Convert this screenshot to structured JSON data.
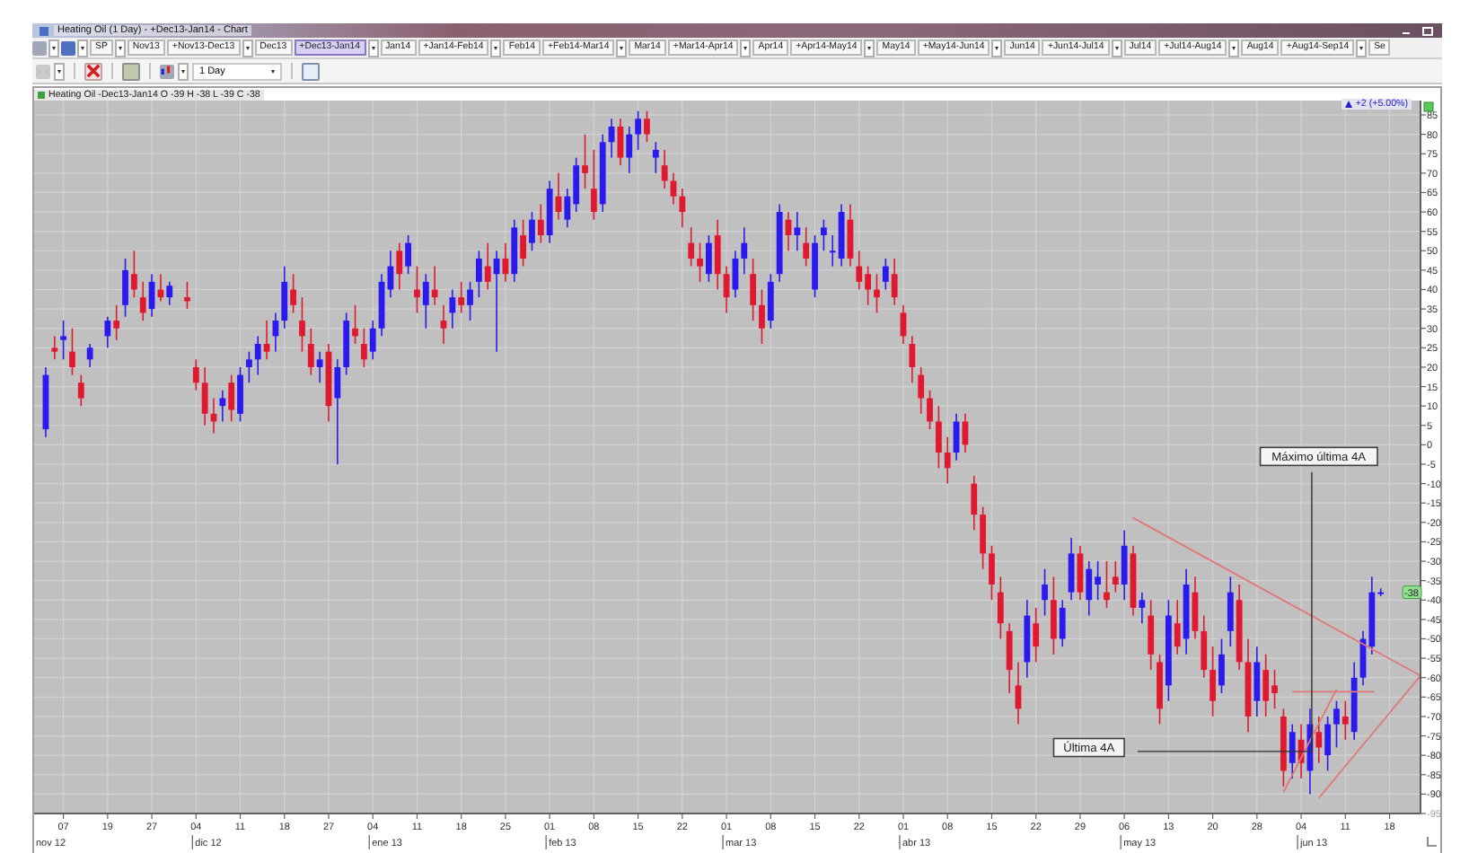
{
  "window": {
    "title": "Heating Oil (1 Day) - +Dec13-Jan14 - Chart"
  },
  "contract_tabs": [
    {
      "label": "SP",
      "kind": "plain",
      "selected": false
    },
    {
      "label": "Nov13",
      "kind": "plain",
      "selected": false
    },
    {
      "label": "+Nov13-Dec13",
      "kind": "spread",
      "selected": false
    },
    {
      "label": "Dec13",
      "kind": "plain",
      "selected": false
    },
    {
      "label": "+Dec13-Jan14",
      "kind": "spread",
      "selected": true
    },
    {
      "label": "Jan14",
      "kind": "plain",
      "selected": false
    },
    {
      "label": "+Jan14-Feb14",
      "kind": "spread",
      "selected": false
    },
    {
      "label": "Feb14",
      "kind": "plain",
      "selected": false
    },
    {
      "label": "+Feb14-Mar14",
      "kind": "spread",
      "selected": false
    },
    {
      "label": "Mar14",
      "kind": "plain",
      "selected": false
    },
    {
      "label": "+Mar14-Apr14",
      "kind": "spread",
      "selected": false
    },
    {
      "label": "Apr14",
      "kind": "plain",
      "selected": false
    },
    {
      "label": "+Apr14-May14",
      "kind": "spread",
      "selected": false
    },
    {
      "label": "May14",
      "kind": "plain",
      "selected": false
    },
    {
      "label": "+May14-Jun14",
      "kind": "spread",
      "selected": false
    },
    {
      "label": "Jun14",
      "kind": "plain",
      "selected": false
    },
    {
      "label": "+Jun14-Jul14",
      "kind": "spread",
      "selected": false
    },
    {
      "label": "Jul14",
      "kind": "plain",
      "selected": false
    },
    {
      "label": "+Jul14-Aug14",
      "kind": "spread",
      "selected": false
    },
    {
      "label": "Aug14",
      "kind": "plain",
      "selected": false
    },
    {
      "label": "+Aug14-Sep14",
      "kind": "spread",
      "selected": false
    },
    {
      "label": "Se",
      "kind": "plain",
      "selected": false
    }
  ],
  "toolbar": {
    "interval": "1 Day"
  },
  "chart": {
    "header": "Heating Oil -Dec13-Jan14 O -39 H -38 L -39 C -38",
    "change": "+2 (+5.00%)",
    "last_price_tag": "-38",
    "month_labels": [
      "nov 12",
      "dic 12",
      "ene 13",
      "feb 13",
      "mar 13",
      "abr 13",
      "may 13",
      "jun 13"
    ],
    "chart_data": {
      "type": "candlestick",
      "grid": true,
      "ylim": [
        -95,
        88.7
      ],
      "yticks": [
        85,
        80,
        75,
        70,
        65,
        60,
        55,
        50,
        45,
        40,
        35,
        30,
        25,
        20,
        15,
        10,
        5,
        0,
        -5,
        -10,
        -15,
        -20,
        -25,
        -30,
        -35,
        -40,
        -45,
        -50,
        -55,
        -60,
        -65,
        -70,
        -75,
        -80,
        -85,
        -90,
        -95
      ],
      "categories": [
        null,
        null,
        "07",
        null,
        null,
        null,
        null,
        "19",
        null,
        null,
        null,
        null,
        "27",
        null,
        null,
        null,
        null,
        "04",
        null,
        null,
        null,
        null,
        "11",
        null,
        null,
        null,
        null,
        "18",
        null,
        null,
        null,
        null,
        "27",
        null,
        null,
        null,
        null,
        "04",
        null,
        null,
        null,
        null,
        "11",
        null,
        null,
        null,
        null,
        "18",
        null,
        null,
        null,
        null,
        "25",
        null,
        null,
        null,
        null,
        "01",
        null,
        null,
        null,
        null,
        "08",
        null,
        null,
        null,
        null,
        "15",
        null,
        null,
        null,
        null,
        "22",
        null,
        null,
        null,
        null,
        "01",
        null,
        null,
        null,
        null,
        "08",
        null,
        null,
        null,
        null,
        "15",
        null,
        null,
        null,
        null,
        "22",
        null,
        null,
        null,
        null,
        "01",
        null,
        null,
        null,
        null,
        "08",
        null,
        null,
        null,
        null,
        "15",
        null,
        null,
        null,
        null,
        "22",
        null,
        null,
        null,
        null,
        "29",
        null,
        null,
        null,
        null,
        "06",
        null,
        null,
        null,
        null,
        "13",
        null,
        null,
        null,
        null,
        "20",
        null,
        null,
        null,
        null,
        "28",
        null,
        null,
        null,
        null,
        "04",
        null,
        null,
        null,
        null,
        "11",
        null,
        null,
        null,
        null,
        "18",
        null,
        null,
        null
      ],
      "ohlc": [
        [
          4,
          20,
          2,
          18
        ],
        [
          25,
          28,
          22,
          24
        ],
        [
          27,
          32,
          22,
          28
        ],
        [
          24,
          30,
          18,
          20
        ],
        [
          16,
          18,
          10,
          12
        ],
        [
          22,
          26,
          20,
          25
        ],
        null,
        [
          28,
          33,
          25,
          32
        ],
        [
          32,
          36,
          27,
          30
        ],
        [
          36,
          48,
          33,
          45
        ],
        [
          44,
          50,
          38,
          40
        ],
        [
          38,
          42,
          32,
          34
        ],
        [
          35,
          44,
          33,
          42
        ],
        [
          40,
          44,
          37,
          38
        ],
        [
          38,
          42,
          36,
          41
        ],
        null,
        [
          38,
          42,
          35,
          37
        ],
        [
          20,
          22,
          14,
          16
        ],
        [
          16,
          20,
          5,
          8
        ],
        [
          8,
          12,
          3,
          6
        ],
        [
          10,
          14,
          6,
          12
        ],
        [
          16,
          18,
          6,
          9
        ],
        [
          8,
          20,
          6,
          18
        ],
        [
          20,
          24,
          16,
          22
        ],
        [
          22,
          28,
          18,
          26
        ],
        [
          26,
          32,
          22,
          24
        ],
        [
          28,
          34,
          24,
          32
        ],
        [
          32,
          46,
          30,
          42
        ],
        [
          40,
          44,
          34,
          36
        ],
        [
          32,
          38,
          24,
          28
        ],
        [
          26,
          30,
          18,
          20
        ],
        [
          20,
          24,
          16,
          22
        ],
        [
          24,
          26,
          6,
          10
        ],
        [
          12,
          22,
          -5,
          20
        ],
        [
          20,
          34,
          18,
          32
        ],
        [
          30,
          36,
          26,
          28
        ],
        [
          26,
          30,
          20,
          22
        ],
        [
          24,
          32,
          22,
          30
        ],
        [
          30,
          44,
          28,
          42
        ],
        [
          40,
          50,
          38,
          46
        ],
        [
          50,
          52,
          40,
          44
        ],
        [
          46,
          54,
          44,
          52
        ],
        [
          40,
          46,
          34,
          38
        ],
        [
          36,
          44,
          30,
          42
        ],
        [
          40,
          46,
          36,
          38
        ],
        [
          32,
          36,
          26,
          30
        ],
        [
          34,
          40,
          30,
          38
        ],
        [
          38,
          42,
          34,
          36
        ],
        [
          36,
          42,
          32,
          40
        ],
        [
          42,
          50,
          38,
          48
        ],
        [
          46,
          52,
          40,
          42
        ],
        [
          44,
          50,
          24,
          48
        ],
        [
          48,
          52,
          42,
          44
        ],
        [
          44,
          58,
          42,
          56
        ],
        [
          54,
          58,
          46,
          48
        ],
        [
          52,
          60,
          50,
          58
        ],
        [
          58,
          62,
          52,
          54
        ],
        [
          54,
          68,
          52,
          66
        ],
        [
          64,
          70,
          58,
          60
        ],
        [
          58,
          66,
          56,
          64
        ],
        [
          62,
          74,
          60,
          72
        ],
        [
          72,
          80,
          66,
          70
        ],
        [
          66,
          76,
          58,
          60
        ],
        [
          62,
          80,
          60,
          78
        ],
        [
          78,
          84,
          74,
          82
        ],
        [
          82,
          84,
          72,
          74
        ],
        [
          74,
          82,
          70,
          80
        ],
        [
          80,
          86,
          76,
          84
        ],
        [
          84,
          86,
          78,
          80
        ],
        [
          74,
          78,
          70,
          76
        ],
        [
          72,
          76,
          66,
          68
        ],
        [
          68,
          70,
          62,
          64
        ],
        [
          64,
          66,
          56,
          60
        ],
        [
          52,
          56,
          46,
          48
        ],
        [
          48,
          52,
          42,
          46
        ],
        [
          44,
          54,
          42,
          52
        ],
        [
          54,
          58,
          40,
          44
        ],
        [
          44,
          46,
          34,
          38
        ],
        [
          40,
          50,
          38,
          48
        ],
        [
          48,
          56,
          44,
          52
        ],
        [
          44,
          48,
          32,
          36
        ],
        [
          36,
          40,
          26,
          30
        ],
        [
          32,
          44,
          30,
          42
        ],
        [
          44,
          62,
          42,
          60
        ],
        [
          58,
          60,
          50,
          54
        ],
        [
          54,
          60,
          50,
          56
        ],
        [
          52,
          56,
          46,
          48
        ],
        [
          40,
          54,
          38,
          52
        ],
        [
          54,
          58,
          50,
          56
        ],
        [
          50,
          54,
          46,
          50
        ],
        [
          48,
          62,
          46,
          60
        ],
        [
          58,
          62,
          46,
          48
        ],
        [
          46,
          50,
          40,
          42
        ],
        [
          44,
          46,
          36,
          40
        ],
        [
          40,
          44,
          34,
          38
        ],
        [
          42,
          48,
          40,
          46
        ],
        [
          44,
          48,
          36,
          38
        ],
        [
          34,
          36,
          26,
          28
        ],
        [
          26,
          28,
          16,
          20
        ],
        [
          18,
          20,
          8,
          12
        ],
        [
          12,
          14,
          4,
          6
        ],
        [
          6,
          10,
          -6,
          -2
        ],
        [
          -2,
          2,
          -10,
          -6
        ],
        [
          -2,
          8,
          -4,
          6
        ],
        [
          6,
          8,
          -2,
          0
        ],
        [
          -10,
          -8,
          -22,
          -18
        ],
        [
          -18,
          -16,
          -32,
          -28
        ],
        [
          -28,
          -26,
          -40,
          -36
        ],
        [
          -38,
          -34,
          -50,
          -46
        ],
        [
          -48,
          -46,
          -64,
          -58
        ],
        [
          -62,
          -56,
          -72,
          -68
        ],
        [
          -56,
          -40,
          -60,
          -44
        ],
        [
          -46,
          -42,
          -56,
          -52
        ],
        [
          -40,
          -32,
          -44,
          -36
        ],
        [
          -40,
          -34,
          -54,
          -50
        ],
        [
          -50,
          -40,
          -52,
          -42
        ],
        [
          -38,
          -24,
          -40,
          -28
        ],
        [
          -28,
          -26,
          -40,
          -38
        ],
        [
          -40,
          -30,
          -44,
          -32
        ],
        [
          -36,
          -30,
          -40,
          -34
        ],
        [
          -38,
          -30,
          -42,
          -40
        ],
        [
          -34,
          -30,
          -38,
          -36
        ],
        [
          -36,
          -22,
          -40,
          -26
        ],
        [
          -28,
          -26,
          -44,
          -42
        ],
        [
          -42,
          -38,
          -46,
          -40
        ],
        [
          -44,
          -40,
          -58,
          -54
        ],
        [
          -56,
          -54,
          -72,
          -68
        ],
        [
          -62,
          -40,
          -66,
          -44
        ],
        [
          -46,
          -40,
          -54,
          -52
        ],
        [
          -50,
          -32,
          -54,
          -36
        ],
        [
          -38,
          -34,
          -50,
          -48
        ],
        [
          -48,
          -44,
          -60,
          -58
        ],
        [
          -58,
          -52,
          -70,
          -66
        ],
        [
          -62,
          -50,
          -64,
          -54
        ],
        [
          -48,
          -34,
          -52,
          -38
        ],
        [
          -40,
          -36,
          -58,
          -56
        ],
        [
          -56,
          -50,
          -74,
          -70
        ],
        [
          -66,
          -52,
          -70,
          -56
        ],
        [
          -58,
          -54,
          -70,
          -66
        ],
        [
          -62,
          -58,
          -68,
          -64
        ],
        [
          -70,
          -68,
          -88,
          -84
        ],
        [
          -82,
          -72,
          -86,
          -74
        ],
        [
          -76,
          -72,
          -86,
          -82
        ],
        [
          -84,
          -68,
          -90,
          -72
        ],
        [
          -74,
          -70,
          -82,
          -78
        ],
        [
          -80,
          -70,
          -84,
          -72
        ],
        [
          -72,
          -66,
          -78,
          -68
        ],
        [
          -70,
          -66,
          -76,
          -72
        ],
        [
          -74,
          -56,
          -76,
          -60
        ],
        [
          -60,
          -48,
          -62,
          -50
        ],
        [
          -52,
          -34,
          -54,
          -38
        ],
        [
          -38,
          -37,
          -39,
          -38
        ],
        null,
        null,
        null,
        null
      ],
      "annotations": [
        "Máximo última 4A",
        "Última 4A"
      ]
    }
  }
}
